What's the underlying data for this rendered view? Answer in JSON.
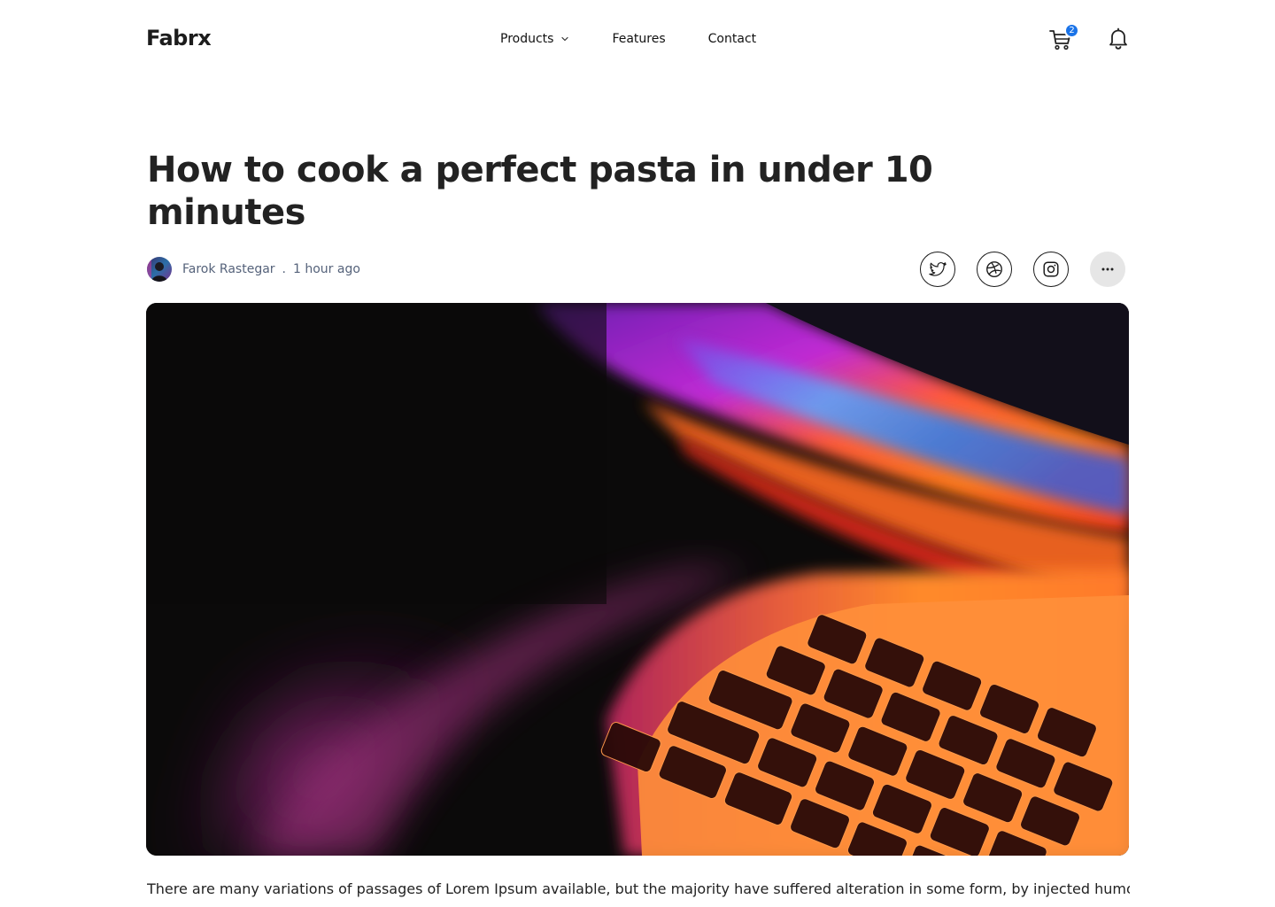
{
  "header": {
    "logo": "Fabrx",
    "nav": [
      {
        "label": "Products",
        "has_dropdown": true
      },
      {
        "label": "Features"
      },
      {
        "label": "Contact"
      }
    ],
    "cart_count": "2",
    "icons": {
      "cart": "cart-icon",
      "bell": "bell-icon",
      "chevron": "chevron-down-icon"
    }
  },
  "article": {
    "title": "How to cook a perfect pasta in under 10 minutes",
    "author": "Farok Rastegar",
    "separator": ".",
    "time": "1 hour ago",
    "social": [
      "twitter-icon",
      "dribbble-icon",
      "instagram-icon",
      "more-icon"
    ],
    "body": "There are many variations of passages of Lorem Ipsum available, but the majority have suffered alteration in some form, by injected humour, or"
  },
  "colors": {
    "accent": "#1a73e8",
    "text": "#222222",
    "meta_text": "#55627a",
    "more_bg": "#e6e6e6"
  }
}
